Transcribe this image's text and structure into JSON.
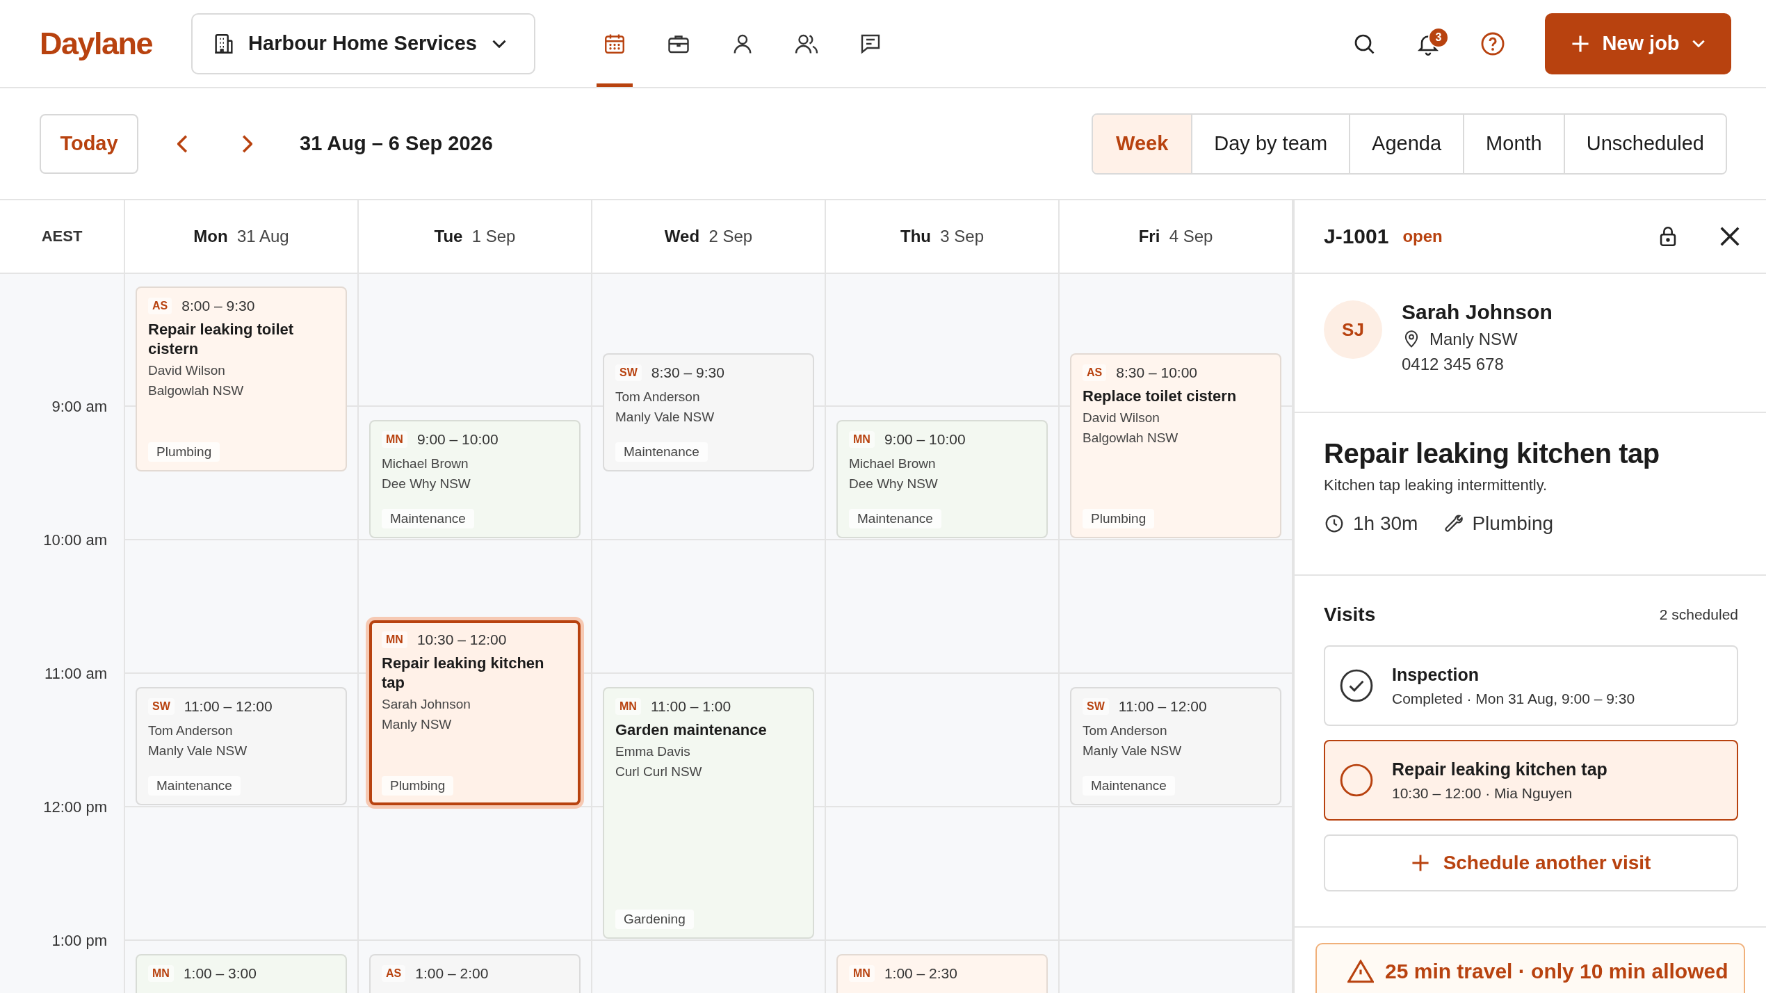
{
  "app": {
    "logo": "Daylane",
    "organization": "Harbour Home Services",
    "nav": [
      {
        "kind": "calendar",
        "selected": true
      },
      {
        "kind": "briefcase",
        "selected": false
      },
      {
        "kind": "person",
        "selected": false
      },
      {
        "kind": "people",
        "selected": false
      },
      {
        "kind": "messages",
        "selected": false
      }
    ],
    "notifications": "3",
    "new_job": "New job"
  },
  "toolbar": {
    "today": "Today",
    "range": "31 Aug – 6 Sep 2026",
    "views": [
      {
        "label": "Week",
        "selected": true
      },
      {
        "label": "Day by team",
        "selected": false
      },
      {
        "label": "Agenda",
        "selected": false
      },
      {
        "label": "Month",
        "selected": false
      },
      {
        "label": "Unscheduled",
        "selected": false
      }
    ]
  },
  "calendar": {
    "timezone": "AEST",
    "hours": [
      "9:00 am",
      "10:00 am",
      "11:00 am",
      "12:00 pm",
      "1:00 pm"
    ],
    "days": [
      {
        "weekday": "Mon",
        "date": "31 Aug",
        "events": [
          {
            "initials": "AS",
            "time": "8:00 – 9:30",
            "title": "Repair leaking toilet cistern",
            "client": "David Wilson",
            "suburb": "Balgowlah NSW",
            "tag": "Plumbing",
            "color": "#fff5ee",
            "selected": false
          },
          {
            "initials": "SW",
            "time": "11:00 – 12:00",
            "client": "Tom Anderson",
            "suburb": "Manly Vale NSW",
            "tag": "Maintenance",
            "color": "#f6f6f6",
            "selected": false
          },
          {
            "initials": "MN",
            "time": "1:00 – 3:00",
            "color": "#f3f8f1",
            "selected": false
          }
        ]
      },
      {
        "weekday": "Tue",
        "date": "1 Sep",
        "events": [
          {
            "initials": "MN",
            "time": "9:00 – 10:00",
            "client": "Michael Brown",
            "suburb": "Dee Why NSW",
            "tag": "Maintenance",
            "color": "#f3f8f1",
            "selected": false
          },
          {
            "initials": "MN",
            "time": "10:30 – 12:00",
            "title": "Repair leaking kitchen tap",
            "client": "Sarah Johnson",
            "suburb": "Manly NSW",
            "tag": "Plumbing",
            "color": "#fff1e8",
            "selected": true
          },
          {
            "initials": "AS",
            "time": "1:00 – 2:00",
            "color": "#f6f6f6",
            "selected": false
          }
        ]
      },
      {
        "weekday": "Wed",
        "date": "2 Sep",
        "events": [
          {
            "initials": "SW",
            "time": "8:30 – 9:30",
            "client": "Tom Anderson",
            "suburb": "Manly Vale NSW",
            "tag": "Maintenance",
            "color": "#f6f6f6",
            "selected": false
          },
          {
            "initials": "MN",
            "time": "11:00 – 1:00",
            "title": "Garden maintenance",
            "client": "Emma Davis",
            "suburb": "Curl Curl NSW",
            "tag": "Gardening",
            "color": "#f3f8f1",
            "selected": false
          }
        ]
      },
      {
        "weekday": "Thu",
        "date": "3 Sep",
        "events": [
          {
            "initials": "MN",
            "time": "9:00 – 10:00",
            "client": "Michael Brown",
            "suburb": "Dee Why NSW",
            "tag": "Maintenance",
            "color": "#f3f8f1",
            "selected": false
          },
          {
            "initials": "MN",
            "time": "1:00 – 2:30",
            "color": "#fff5ee",
            "selected": false
          }
        ]
      },
      {
        "weekday": "Fri",
        "date": "4 Sep",
        "events": [
          {
            "initials": "AS",
            "time": "8:30 – 10:00",
            "title": "Replace toilet cistern",
            "client": "David Wilson",
            "suburb": "Balgowlah NSW",
            "tag": "Plumbing",
            "color": "#fff5ee",
            "selected": false
          },
          {
            "initials": "SW",
            "time": "11:00 – 12:00",
            "client": "Tom Anderson",
            "suburb": "Manly Vale NSW",
            "tag": "Maintenance",
            "color": "#f6f6f6",
            "selected": false
          }
        ]
      }
    ]
  },
  "panel": {
    "job_id": "J-1001",
    "status": "open",
    "customer": {
      "initials": "SJ",
      "name": "Sarah Johnson",
      "suburb": "Manly NSW",
      "phone": "0412 345 678"
    },
    "job": {
      "title": "Repair leaking kitchen tap",
      "description": "Kitchen tap leaking intermittently.",
      "duration": "1h 30m",
      "trade": "Plumbing"
    },
    "visits_title": "Visits",
    "visits_count": "2 scheduled",
    "visits": [
      {
        "title": "Inspection",
        "detail": "Completed · Mon 31 Aug, 9:00 – 9:30",
        "completed": true,
        "selected": false
      },
      {
        "title": "Repair leaking kitchen tap",
        "detail": "10:30 – 12:00 · Mia Nguyen",
        "completed": false,
        "selected": true
      }
    ],
    "schedule_button": "Schedule another visit",
    "warning": "25 min travel · only 10 min allowed"
  }
}
